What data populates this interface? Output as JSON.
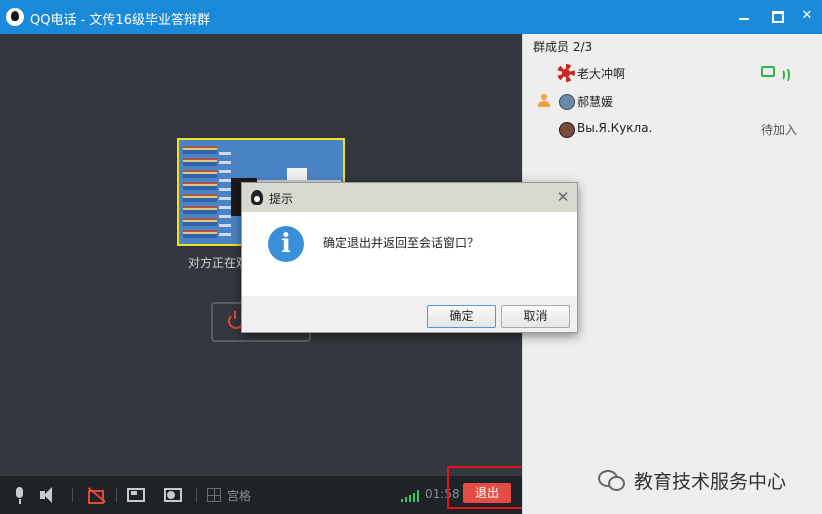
{
  "window": {
    "title": "QQ电话 - 文传16级毕业答辩群",
    "minimize_label": "",
    "maximize_label": "",
    "close_label": "✕"
  },
  "video": {
    "status_text": "对方正在观看你的屏幕"
  },
  "toolbar": {
    "grid_label": "宫格",
    "timer": "01:58",
    "exit_label": "退出",
    "icons": [
      "microphone-icon",
      "speaker-icon",
      "camera-off-icon",
      "screen-share-icon",
      "presenter-icon",
      "grid-icon",
      "signal-icon"
    ]
  },
  "members": {
    "header": "群成员 2/3",
    "list": [
      {
        "name": "老大冲啊",
        "state": "",
        "avatar_color": "#c82a20"
      },
      {
        "name": "郝慧媛",
        "state": "",
        "avatar_color": "#6a8aa8"
      },
      {
        "name": "Вы.Я.Кукла.",
        "state": "待加入",
        "avatar_color": "#7a4a3a"
      }
    ]
  },
  "dialog": {
    "title": "提示",
    "close_label": "✕",
    "message": "确定退出并返回至会话窗口？",
    "ok_label": "确定",
    "cancel_label": "取消"
  },
  "watermark": {
    "text": "教育技术服务中心"
  },
  "colors": {
    "titlebar": "#1a8ad8",
    "video_bg": "#33373e",
    "toolbar_bg": "#1f2226",
    "exit_button": "#e34d43",
    "highlight_box": "#e2131b",
    "signal_green": "#3cc85a",
    "info_blue": "#3a8fd9"
  }
}
